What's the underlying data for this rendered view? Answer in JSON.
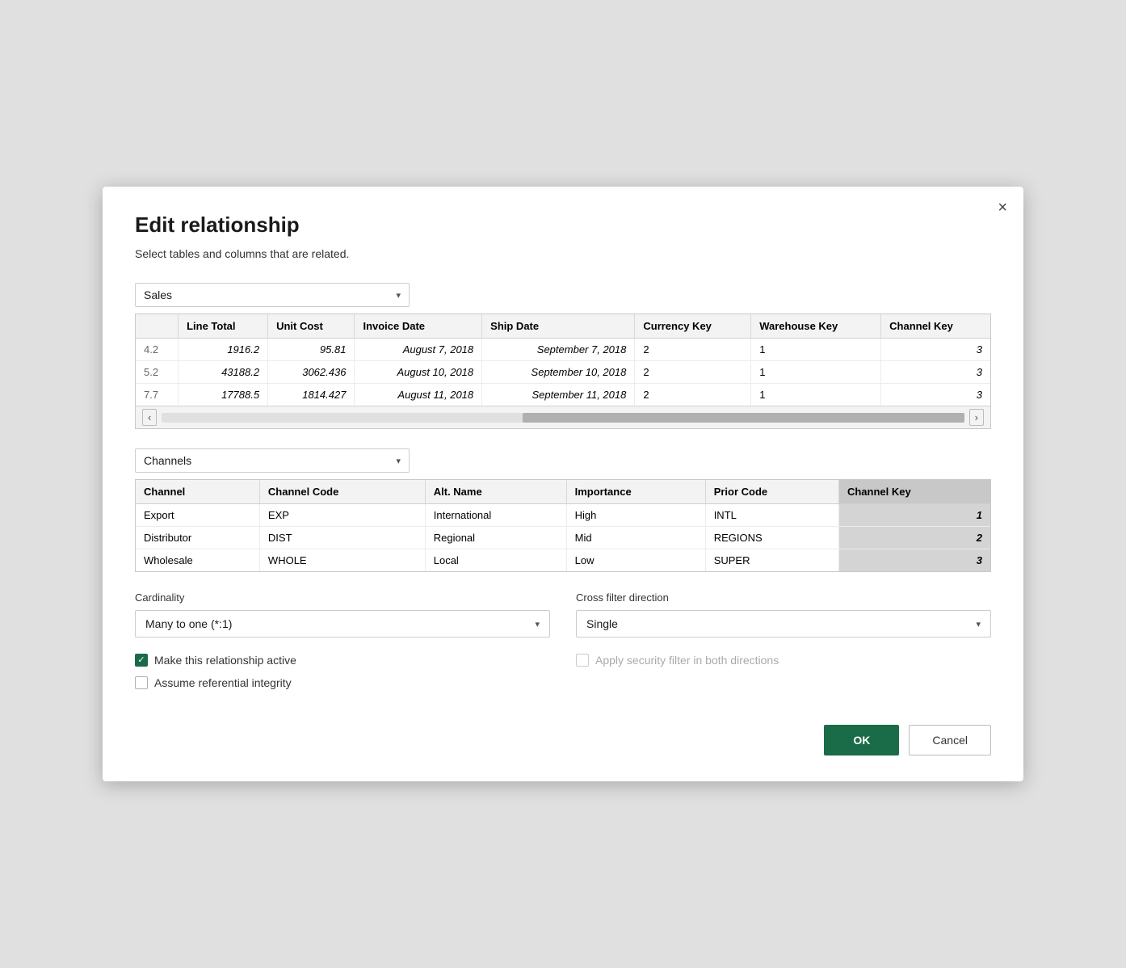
{
  "dialog": {
    "title": "Edit relationship",
    "subtitle": "Select tables and columns that are related.",
    "close_label": "×"
  },
  "table1": {
    "dropdown_value": "Sales",
    "chevron": "▾",
    "columns": [
      "",
      "Line Total",
      "Unit Cost",
      "Invoice Date",
      "Ship Date",
      "Currency Key",
      "Warehouse Key",
      "Channel Key"
    ],
    "rows": [
      {
        "num": "4.2",
        "line_total": "1916.2",
        "unit_cost": "95.81",
        "invoice_date": "August 7, 2018",
        "ship_date": "September 7, 2018",
        "currency_key": "2",
        "warehouse_key": "1",
        "channel_key": "3"
      },
      {
        "num": "5.2",
        "line_total": "43188.2",
        "unit_cost": "3062.436",
        "invoice_date": "August 10, 2018",
        "ship_date": "September 10, 2018",
        "currency_key": "2",
        "warehouse_key": "1",
        "channel_key": "3"
      },
      {
        "num": "7.7",
        "line_total": "17788.5",
        "unit_cost": "1814.427",
        "invoice_date": "August 11, 2018",
        "ship_date": "September 11, 2018",
        "currency_key": "2",
        "warehouse_key": "1",
        "channel_key": "3"
      }
    ]
  },
  "table2": {
    "dropdown_value": "Channels",
    "chevron": "▾",
    "columns": [
      "Channel",
      "Channel Code",
      "Alt. Name",
      "Importance",
      "Prior Code",
      "Channel Key"
    ],
    "rows": [
      {
        "channel": "Export",
        "code": "EXP",
        "alt_name": "International",
        "importance": "High",
        "prior_code": "INTL",
        "channel_key": "1"
      },
      {
        "channel": "Distributor",
        "code": "DIST",
        "alt_name": "Regional",
        "importance": "Mid",
        "prior_code": "REGIONS",
        "channel_key": "2"
      },
      {
        "channel": "Wholesale",
        "code": "WHOLE",
        "alt_name": "Local",
        "importance": "Low",
        "prior_code": "SUPER",
        "channel_key": "3"
      }
    ]
  },
  "cardinality": {
    "label": "Cardinality",
    "value": "Many to one (*:1)",
    "chevron": "▾"
  },
  "cross_filter": {
    "label": "Cross filter direction",
    "value": "Single",
    "chevron": "▾"
  },
  "checkbox1": {
    "label": "Make this relationship active",
    "checked": true
  },
  "checkbox2": {
    "label": "Apply security filter in both directions",
    "checked": false,
    "disabled": true
  },
  "checkbox3": {
    "label": "Assume referential integrity",
    "checked": false
  },
  "buttons": {
    "ok": "OK",
    "cancel": "Cancel"
  }
}
